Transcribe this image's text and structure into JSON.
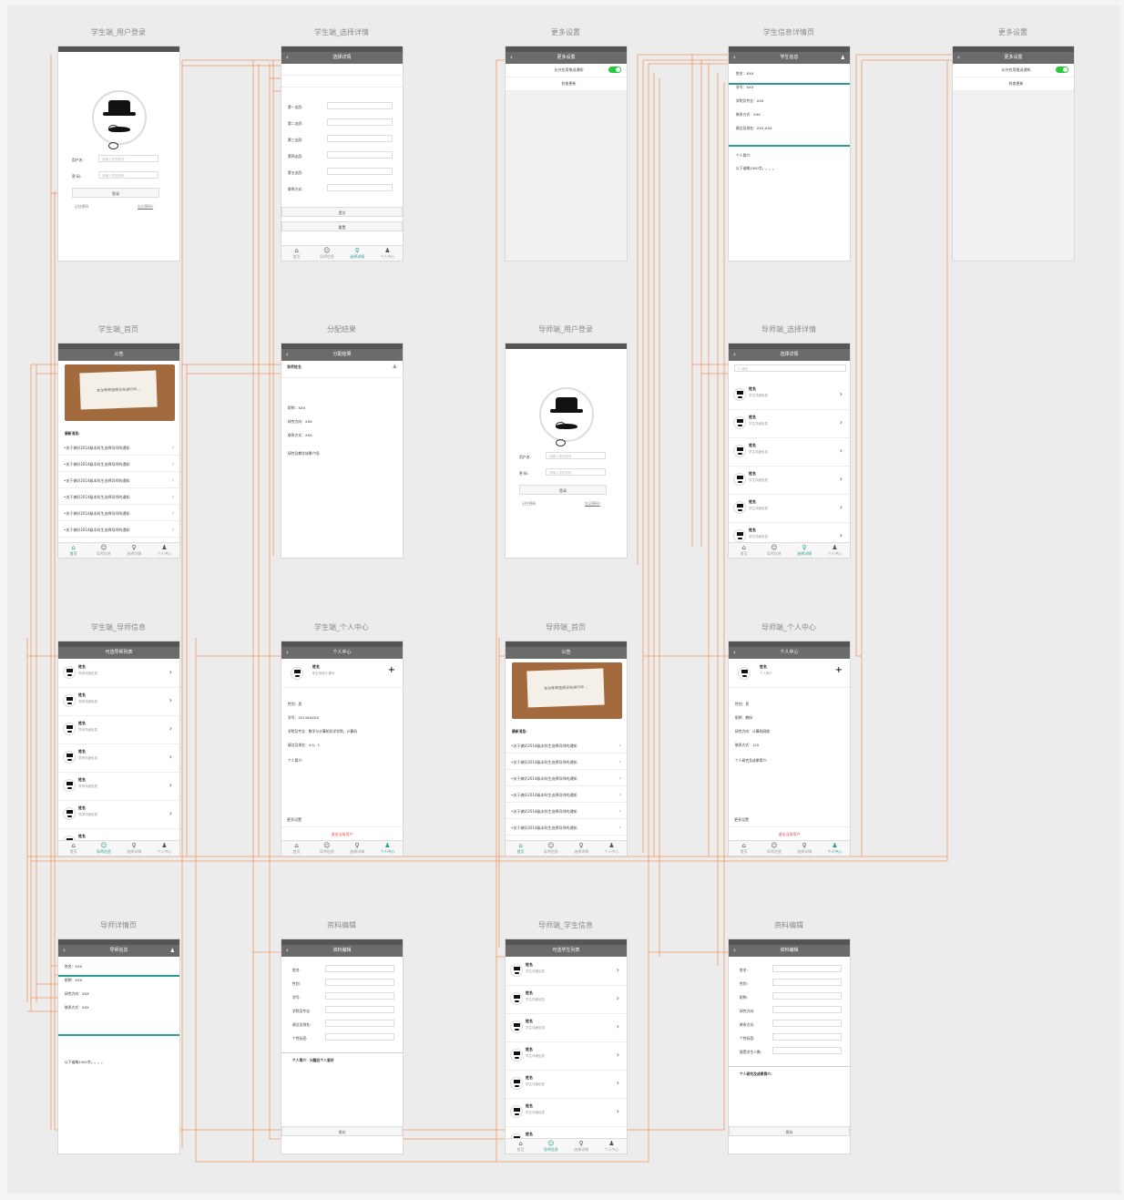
{
  "screens": {
    "s1": {
      "title": "学生端_用户登录",
      "bar": "",
      "user_label": "用户名:",
      "pwd_label": "密 码:",
      "user_ph": "请输入您的账号",
      "pwd_ph": "请输入您的密码",
      "login": "登录",
      "remember": "记住密码",
      "forgot": "忘记密码?"
    },
    "s2": {
      "title": "学生端_选择详情",
      "bar": "选择详情",
      "rows": [
        "第一志愿:",
        "第二志愿:",
        "第三志愿:",
        "第四志愿:",
        "第五志愿:",
        "联系方式:"
      ],
      "submit": "提交",
      "reset": "重置"
    },
    "s3": {
      "title": "更多设置",
      "bar": "更多设置",
      "opt1": "允许应用推送通知",
      "opt2": "检查更新"
    },
    "s4": {
      "title": "学生信息详情页",
      "bar": "学生信息",
      "fields": [
        "姓名：XXX",
        "学号：XXX",
        "学院及专业：XXX",
        "联系方式：XXX",
        "绩点及排名：XXX,XXX"
      ],
      "intro_label": "个人简介:",
      "intro": "以下省略1000字。。。。"
    },
    "s5": {
      "title": "更多设置",
      "bar": "更多设置",
      "opt1": "允许应用推送通知",
      "opt2": "检查更新"
    },
    "s6": {
      "title": "学生端_首页",
      "bar": "公告",
      "notice": "本次导师选择正在进行中...",
      "news_label": "最新消息:",
      "news_item": "•关于做好2014级本科生选择导师的通知"
    },
    "s7": {
      "title": "分配结果",
      "bar": "分配结果",
      "teacher": "导师姓名",
      "lines": [
        "职称：XXX",
        "研究方向：XXX",
        "联系方式：XXX"
      ],
      "intro": "研究及教学成果介绍:"
    },
    "s8": {
      "title": "导师端_用户登录",
      "bar": "",
      "user_label": "用户名:",
      "pwd_label": "密 码:",
      "user_ph": "请输入您的账号",
      "pwd_ph": "请输入您的密码",
      "login": "登录",
      "remember": "记住密码",
      "forgot": "忘记密码?"
    },
    "s9": {
      "title": "导师端_选择详情",
      "bar": "选择详情",
      "search": "Q 搜索",
      "item_name": "姓名",
      "item_sub": "学生详细信息"
    },
    "s10": {
      "title": "学生端_导师信息",
      "bar": "可选导师列表",
      "item_name": "姓名",
      "item_sub": "导师详细信息"
    },
    "s11": {
      "title": "学生端_个人中心",
      "bar": "个人中心",
      "name": "姓名",
      "sub": "职业规划小课写",
      "lines": [
        "性别：男",
        "学号：2014XXXXX",
        "学院及专业：数学与计算机科学学院，计算机",
        "绩点及排名：4.5，1"
      ],
      "intro": "个人简介:",
      "more": "更多设置",
      "logout": "退出当前用户"
    },
    "s12": {
      "title": "导师端_首页",
      "bar": "公告",
      "notice": "本次导师选择正在进行中...",
      "news_label": "最新消息:",
      "news_item": "•关于做好2014级本科生选择导师的通知"
    },
    "s13": {
      "title": "导师端_个人中心",
      "bar": "个人中心",
      "name": "姓名",
      "sub": "个人简介",
      "lines": [
        "性别：男",
        "职称：教授",
        "研究方向：计算机网络",
        "联系方式：120"
      ],
      "intro": "个人研究及成果简介:",
      "more": "更多设置",
      "logout": "退出当前用户"
    },
    "s14": {
      "title": "导师详情页",
      "bar": "导师信息",
      "fields": [
        "姓名：XXX",
        "职称：XXX",
        "研究方向：XXX",
        "联系方式：XXX"
      ],
      "intro": "以下省略1000字。。。。"
    },
    "s15": {
      "title": "资料编辑",
      "bar": "资料编辑",
      "fields": [
        "姓名:",
        "性别:",
        "学号:",
        "学院及专业:",
        "绩点及排名:",
        "个性标签:"
      ],
      "intro": "个人简介：兴趣及个人爱好",
      "save": "保存"
    },
    "s16": {
      "title": "导师端_学生信息",
      "bar": "可选学生列表",
      "item_name": "姓名",
      "item_sub": "学生详细信息"
    },
    "s17": {
      "title": "资料编辑",
      "bar": "资料编辑",
      "fields": [
        "姓名:",
        "性别:",
        "职称:",
        "研究方向:",
        "联系方式:",
        "个性标签:",
        "接受学生人数:"
      ],
      "intro": "个人研究及成果简介:",
      "save": "保存"
    }
  },
  "tabs": [
    "首页",
    "导师信息",
    "选择详情",
    "个人中心"
  ],
  "colors": {
    "accent": "#2a9d8f",
    "link": "#f08a4b",
    "bar": "#6b6b6b"
  }
}
